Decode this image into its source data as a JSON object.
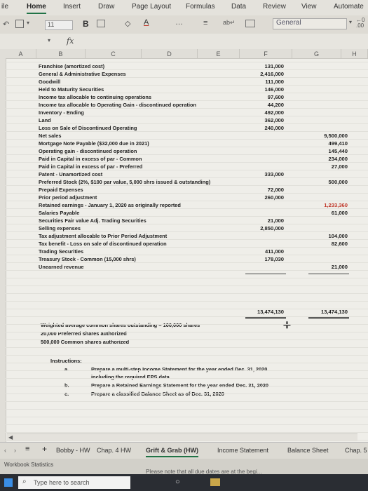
{
  "ribbon": {
    "tabs": [
      "ile",
      "Home",
      "Insert",
      "Draw",
      "Page Layout",
      "Formulas",
      "Data",
      "Review",
      "View",
      "Automate"
    ],
    "active_tab": "Home"
  },
  "toolbar": {
    "font_size": "11",
    "bold_label": "B",
    "font_color_label": "A",
    "number_format": "General",
    "more": "…"
  },
  "formula_bar": {
    "fx": "fx"
  },
  "columns": [
    "A",
    "B",
    "C",
    "D",
    "E",
    "F",
    "G",
    "H"
  ],
  "rows": [
    {
      "label": "Franchise (amortized cost)",
      "f": "131,000",
      "g": ""
    },
    {
      "label": "General & Administrative Expenses",
      "f": "2,416,000",
      "g": ""
    },
    {
      "label": "Goodwill",
      "f": "111,000",
      "g": ""
    },
    {
      "label": "Held to Maturity Securities",
      "f": "146,000",
      "g": ""
    },
    {
      "label": "Income tax allocable to continuing operations",
      "f": "97,600",
      "g": ""
    },
    {
      "label": "Income tax allocable to Operating Gain - discontinued operation",
      "f": "44,200",
      "g": ""
    },
    {
      "label": "Inventory - Ending",
      "f": "492,000",
      "g": ""
    },
    {
      "label": "Land",
      "f": "362,000",
      "g": ""
    },
    {
      "label": "Loss on Sale of Discontinued Operating",
      "f": "240,000",
      "g": ""
    },
    {
      "label": "Net sales",
      "f": "",
      "g": "9,500,000"
    },
    {
      "label": "Mortgage Note Payable ($32,000 due in 2021)",
      "f": "",
      "g": "499,410"
    },
    {
      "label": "Operating gain - discontinued operation",
      "f": "",
      "g": "145,440"
    },
    {
      "label": "Paid in Capital in excess of par - Common",
      "f": "",
      "g": "234,000"
    },
    {
      "label": "Paid in Capital in excess of par - Preferred",
      "f": "",
      "g": "27,000"
    },
    {
      "label": "Patent - Unamortized cost",
      "f": "333,000",
      "g": ""
    },
    {
      "label": "Preferred Stock (2%, $100 par value, 5,000 shrs issued & outstanding)",
      "f": "",
      "g": "500,000"
    },
    {
      "label": "Prepaid Expenses",
      "f": "72,000",
      "g": ""
    },
    {
      "label": "Prior period adjustment",
      "f": "260,000",
      "g": ""
    },
    {
      "label": "Retained earnings - January 1, 2020 as originally reported",
      "f": "",
      "g": "1,233,360"
    },
    {
      "label": "Salaries Payable",
      "f": "",
      "g": "61,000"
    },
    {
      "label": "Securities Fair value Adj. Trading Securities",
      "f": "21,000",
      "g": ""
    },
    {
      "label": "Selling expenses",
      "f": "2,850,000",
      "g": ""
    },
    {
      "label": "Tax adjustment allocable to Prior Period Adjustment",
      "f": "",
      "g": "104,000"
    },
    {
      "label": "Tax benefit - Loss on sale of discontinued operation",
      "f": "",
      "g": "82,600"
    },
    {
      "label": "Trading Securities",
      "f": "411,000",
      "g": ""
    },
    {
      "label": "Treasury Stock - Common (15,000 shrs)",
      "f": "178,030",
      "g": ""
    },
    {
      "label": "Unearned revenue",
      "f": "",
      "g": "21,000"
    }
  ],
  "totals": {
    "f": "13,474,130",
    "g": "13,474,130"
  },
  "notes": [
    "Weighted average common shares outstanding = 100,000 shares",
    "20,000 Preferred shares authorized",
    "500,000 Common shares authorized"
  ],
  "instructions": {
    "heading": "Instructions:",
    "items": [
      {
        "letter": "a.",
        "text": "Prepare a multi-step Income Statement for the year ended Dec. 31, 2020"
      },
      {
        "letter": "",
        "text": "including the required EPS data"
      },
      {
        "letter": "b.",
        "text": "Prepare a Retained Earnings Statement for the year ended Dec. 31, 2020"
      },
      {
        "letter": "c.",
        "text": "Prepare a classified Balance Sheet as of Dec. 31, 2020"
      }
    ]
  },
  "sheet_tabs": [
    "Bobby - HW",
    "Chap. 4 HW",
    "Grift & Grab (HW)",
    "Income Statement",
    "Balance Sheet",
    "Chap. 5"
  ],
  "active_sheet": "Grift & Grab (HW)",
  "status": {
    "left": "Workbook Statistics",
    "notice": "Please note that all due dates are at the begi..."
  },
  "taskbar": {
    "search_placeholder": "Type here to search"
  },
  "colors": {
    "accent": "#217346",
    "red_value": "#c0392b"
  }
}
